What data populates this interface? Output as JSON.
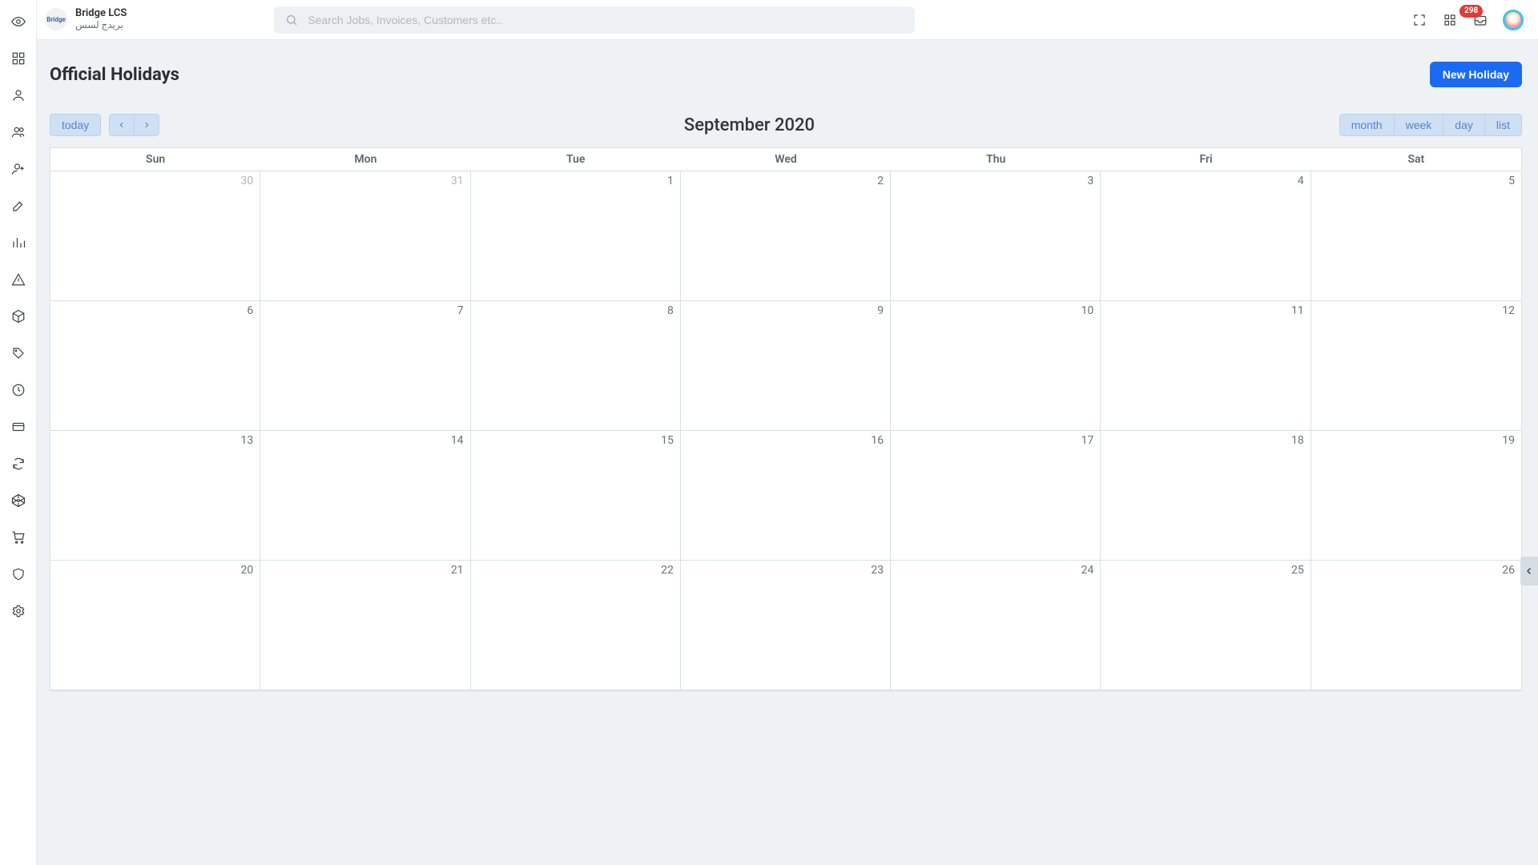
{
  "brand": {
    "title": "Bridge LCS",
    "subtitle": "بريدج لسس",
    "logo_label": "Bridge"
  },
  "search": {
    "placeholder": "Search Jobs, Invoices, Customers etc.."
  },
  "top": {
    "badge_count": "298"
  },
  "page": {
    "title": "Official Holidays",
    "new_button": "New Holiday"
  },
  "calendar": {
    "title": "September 2020",
    "today_label": "today",
    "views": {
      "month": "month",
      "week": "week",
      "day": "day",
      "list": "list"
    },
    "day_headers": [
      "Sun",
      "Mon",
      "Tue",
      "Wed",
      "Thu",
      "Fri",
      "Sat"
    ],
    "weeks": [
      [
        {
          "n": "30",
          "other": true
        },
        {
          "n": "31",
          "other": true
        },
        {
          "n": "1"
        },
        {
          "n": "2"
        },
        {
          "n": "3"
        },
        {
          "n": "4"
        },
        {
          "n": "5"
        }
      ],
      [
        {
          "n": "6"
        },
        {
          "n": "7"
        },
        {
          "n": "8"
        },
        {
          "n": "9"
        },
        {
          "n": "10"
        },
        {
          "n": "11"
        },
        {
          "n": "12"
        }
      ],
      [
        {
          "n": "13"
        },
        {
          "n": "14"
        },
        {
          "n": "15"
        },
        {
          "n": "16"
        },
        {
          "n": "17"
        },
        {
          "n": "18"
        },
        {
          "n": "19"
        }
      ],
      [
        {
          "n": "20"
        },
        {
          "n": "21"
        },
        {
          "n": "22"
        },
        {
          "n": "23"
        },
        {
          "n": "24"
        },
        {
          "n": "25"
        },
        {
          "n": "26"
        }
      ]
    ]
  },
  "sidebar": [
    "eye",
    "dashboard",
    "user",
    "users",
    "user-add",
    "edit",
    "chart",
    "warning",
    "package",
    "tag",
    "clock",
    "card",
    "refresh",
    "codepen",
    "cart",
    "shield",
    "gear"
  ]
}
